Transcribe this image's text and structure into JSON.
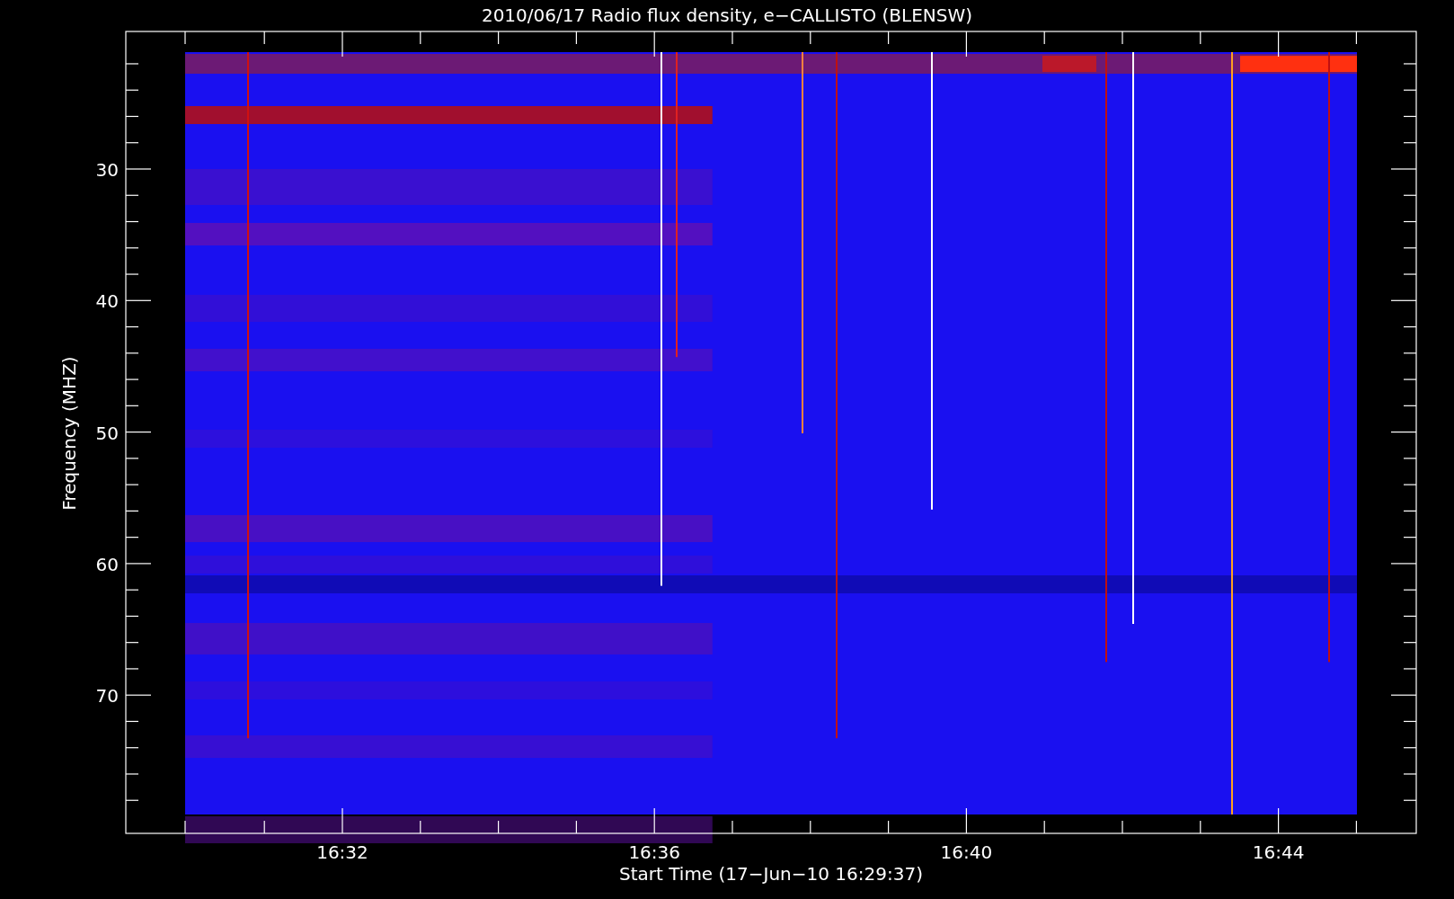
{
  "plot": {
    "title": "2010/06/17  Radio flux density, e−CALLISTO (BLENSW)",
    "ylabel": "Frequency (MHZ)",
    "xlabel": "Start Time (17−Jun−10 16:29:37)",
    "yticks": [
      "30",
      "40",
      "50",
      "60",
      "70"
    ],
    "xticks": [
      "16:32",
      "16:36",
      "16:40",
      "16:44"
    ]
  }
}
